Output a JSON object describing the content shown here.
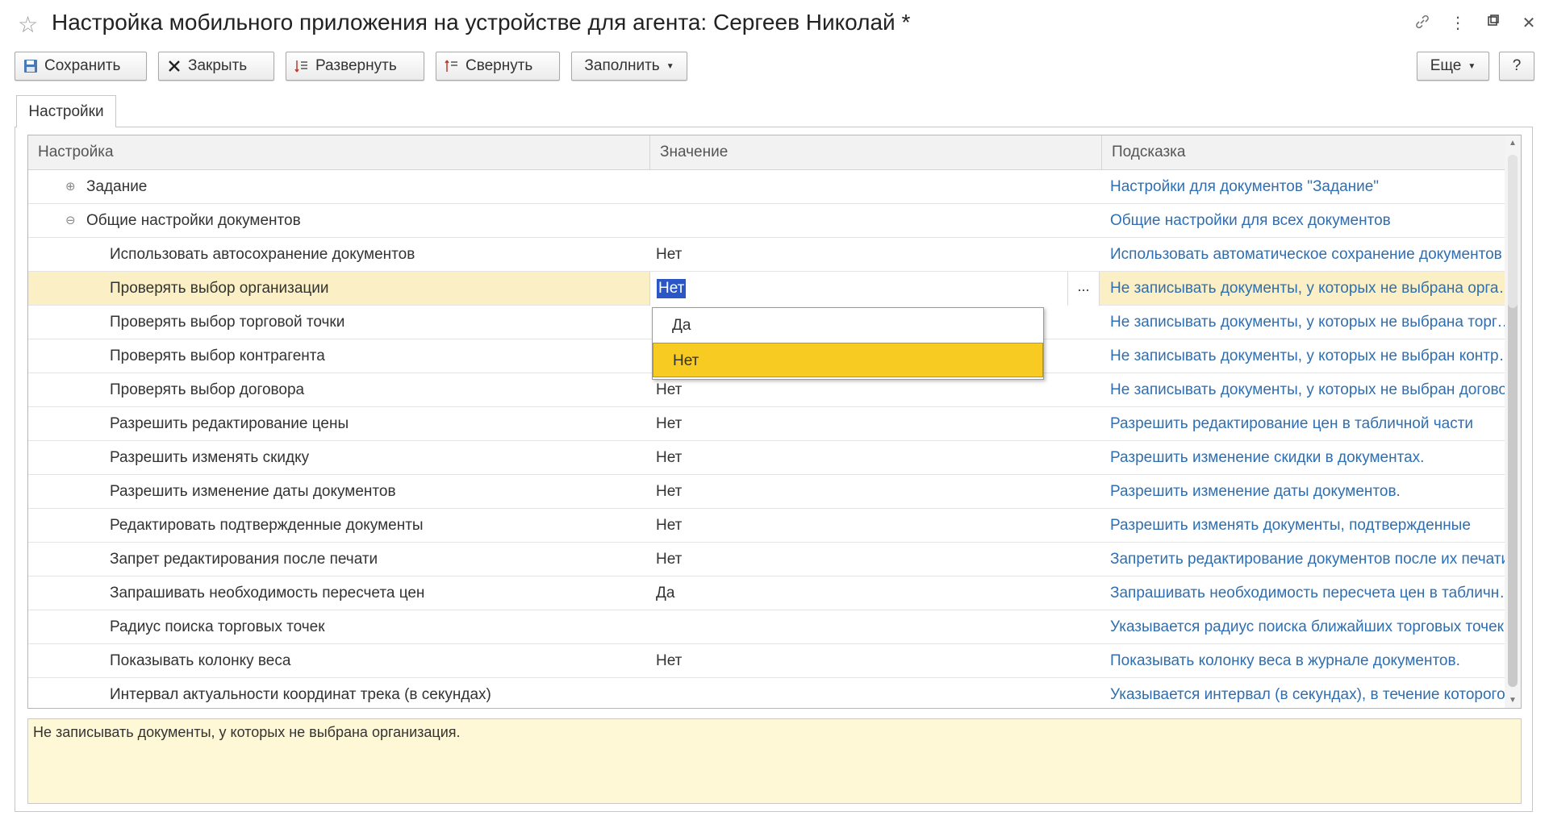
{
  "window": {
    "title": "Настройка мобильного приложения на устройстве для агента: Сергеев Николай *",
    "star_icon": "☆",
    "link_icon": "🔗",
    "more_icon": "⋮",
    "maximize_icon": "▭",
    "close_icon": "✕"
  },
  "toolbar": {
    "save_label": "Сохранить",
    "close_label": "Закрыть",
    "expand_label": "Развернуть",
    "collapse_label": "Свернуть",
    "fill_label": "Заполнить",
    "more_label": "Еще",
    "help_label": "?"
  },
  "tabs": [
    {
      "label": "Настройки"
    }
  ],
  "table": {
    "columns": [
      "Настройка",
      "Значение",
      "Подсказка"
    ],
    "rows": [
      {
        "name": "Задание",
        "value": "",
        "hint": "Настройки для документов \"Задание\""
      },
      {
        "name": "Общие настройки документов",
        "value": "",
        "hint": "Общие настройки для всех документов"
      },
      {
        "name": "Использовать автосохранение документов",
        "value": "Нет",
        "hint": "Использовать автоматическое сохранение документов"
      },
      {
        "name": "Проверять выбор организации",
        "value": "Нет",
        "hint": "Не записывать документы, у которых не выбрана организация"
      },
      {
        "name": "Проверять выбор торговой точки",
        "value": "",
        "hint": "Не записывать документы, у которых не выбрана торговая точка"
      },
      {
        "name": "Проверять выбор контрагента",
        "value": "",
        "hint": "Не записывать документы, у которых не выбран контрагент"
      },
      {
        "name": "Проверять выбор договора",
        "value": "Нет",
        "hint": "Не записывать документы, у которых не выбран договор"
      },
      {
        "name": "Разрешить редактирование цены",
        "value": "Нет",
        "hint": "Разрешить редактирование цен в табличной части"
      },
      {
        "name": "Разрешить изменять скидку",
        "value": "Нет",
        "hint": "Разрешить изменение скидки в документах."
      },
      {
        "name": "Разрешить изменение даты документов",
        "value": "Нет",
        "hint": "Разрешить изменение даты документов."
      },
      {
        "name": "Редактировать подтвержденные документы",
        "value": "Нет",
        "hint": "Разрешить изменять документы, подтвержденные"
      },
      {
        "name": "Запрет редактирования после печати",
        "value": "Нет",
        "hint": "Запретить редактирование документов после их печати"
      },
      {
        "name": "Запрашивать необходимость пересчета цен",
        "value": "Да",
        "hint": "Запрашивать необходимость пересчета цен в табличной части"
      },
      {
        "name": "Радиус поиска торговых точек",
        "value": "",
        "hint": "Указывается радиус поиска ближайших торговых точек"
      },
      {
        "name": "Показывать колонку веса",
        "value": "Нет",
        "hint": "Показывать колонку веса в журнале документов."
      },
      {
        "name": "Интервал актуальности координат трека (в секундах)",
        "value": "",
        "hint": "Указывается интервал (в секундах), в течение которого"
      }
    ],
    "edit_dots": "..."
  },
  "dropdown": {
    "options": [
      "Да",
      "Нет"
    ],
    "selected": "Нет"
  },
  "hint_text": "Не записывать документы, у которых не выбрана организация.",
  "colors": {
    "selected_row": "#fbf0c5",
    "hint_link": "#2f6fb1",
    "dropdown_active": "#f7cb22",
    "hint_area": "#fff8d6"
  }
}
